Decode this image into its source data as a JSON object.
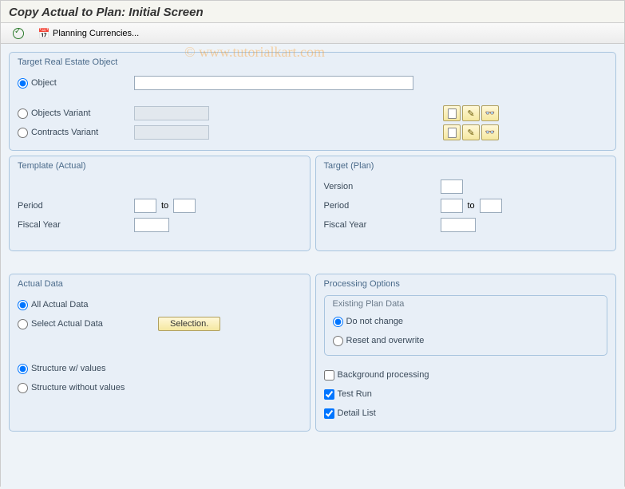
{
  "title": "Copy Actual to Plan: Initial Screen",
  "watermark": "©   www.tutorialkart.com",
  "toolbar": {
    "planning_currencies": "Planning Currencies..."
  },
  "groups": {
    "target_reo": {
      "title": "Target Real Estate Object",
      "object": "Object",
      "objects_variant": "Objects Variant",
      "contracts_variant": "Contracts Variant"
    },
    "template_actual": {
      "title": "Template (Actual)",
      "period": "Period",
      "to": "to",
      "fiscal_year": "Fiscal Year"
    },
    "target_plan": {
      "title": "Target (Plan)",
      "version": "Version",
      "period": "Period",
      "to": "to",
      "fiscal_year": "Fiscal Year"
    },
    "actual_data": {
      "title": "Actual Data",
      "all": "All Actual Data",
      "select": "Select Actual Data",
      "selection_btn": "Selection.",
      "struct_with": "Structure w/ values",
      "struct_without": "Structure without values"
    },
    "processing": {
      "title": "Processing Options",
      "existing": {
        "title": "Existing Plan Data",
        "no_change": "Do not change",
        "reset": "Reset and overwrite"
      },
      "background": "Background processing",
      "test_run": "Test Run",
      "detail_list": "Detail List"
    }
  }
}
